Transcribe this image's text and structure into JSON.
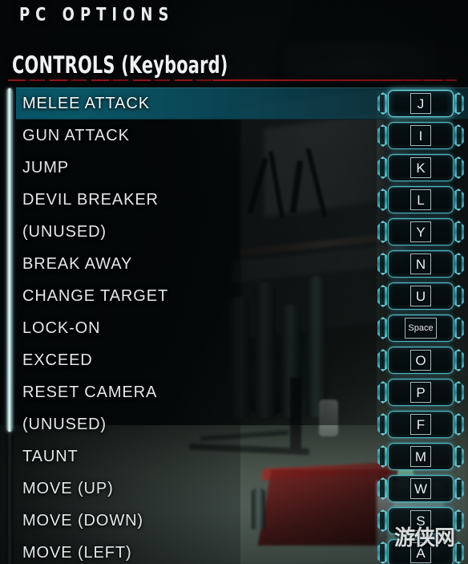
{
  "header": {
    "page_title": "PC OPTIONS",
    "section_title": "CONTROLS (Keyboard)"
  },
  "scrollbar": {
    "name": "options-scrollbar"
  },
  "watermark": {
    "text": "游侠网"
  },
  "colors": {
    "accent_cyan": "#5cd6e2",
    "selected_row_bg": "#095669",
    "divider_red": "#a8161a",
    "label_text": "#e2e8ea",
    "scroll_thumb": "#e9f6f7"
  },
  "options": [
    {
      "label": "MELEE ATTACK",
      "key": "J",
      "selected": true
    },
    {
      "label": "GUN ATTACK",
      "key": "I",
      "selected": false
    },
    {
      "label": "JUMP",
      "key": "K",
      "selected": false
    },
    {
      "label": "DEVIL BREAKER",
      "key": "L",
      "selected": false
    },
    {
      "label": "(UNUSED)",
      "key": "Y",
      "selected": false
    },
    {
      "label": "BREAK AWAY",
      "key": "N",
      "selected": false
    },
    {
      "label": "CHANGE TARGET",
      "key": "U",
      "selected": false
    },
    {
      "label": "LOCK-ON",
      "key": "Space",
      "selected": false
    },
    {
      "label": "EXCEED",
      "key": "O",
      "selected": false
    },
    {
      "label": "RESET CAMERA",
      "key": "P",
      "selected": false
    },
    {
      "label": "(UNUSED)",
      "key": "F",
      "selected": false
    },
    {
      "label": "TAUNT",
      "key": "M",
      "selected": false
    },
    {
      "label": "MOVE (UP)",
      "key": "W",
      "selected": false
    },
    {
      "label": "MOVE (DOWN)",
      "key": "S",
      "selected": false
    },
    {
      "label": "MOVE (LEFT)",
      "key": "A",
      "selected": false
    }
  ]
}
